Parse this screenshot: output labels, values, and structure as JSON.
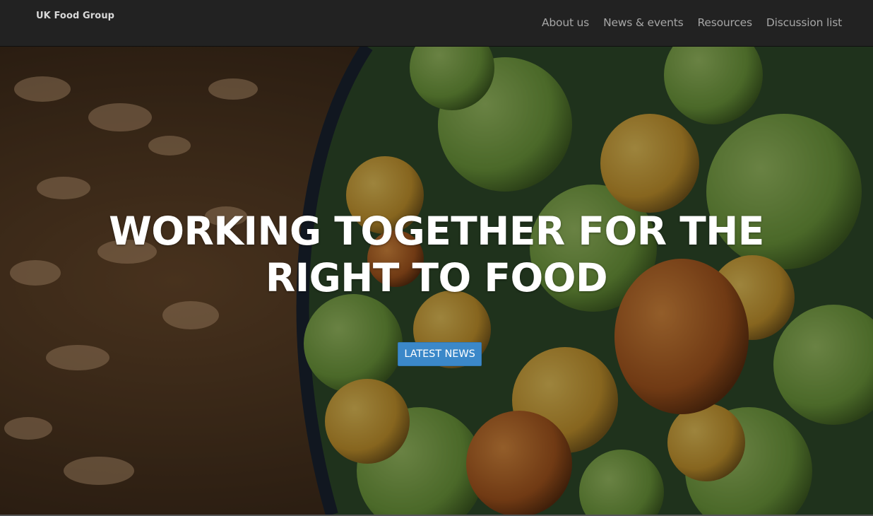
{
  "navbar": {
    "brand": "UK Food Group",
    "links": [
      {
        "label": "About us"
      },
      {
        "label": "News & events"
      },
      {
        "label": "Resources"
      },
      {
        "label": "Discussion list"
      }
    ]
  },
  "hero": {
    "heading": "WORKING TOGETHER FOR THE RIGHT TO FOOD",
    "button_label": "LATEST NEWS",
    "image_description": "basin of green and orange fruits beside peanut shells on soil"
  },
  "colors": {
    "navbar_bg": "#222222",
    "brand_text": "#d9d9d9",
    "nav_link_text": "#a6a6a6",
    "button_bg": "#3b88c9",
    "heading_text": "#ffffff"
  }
}
